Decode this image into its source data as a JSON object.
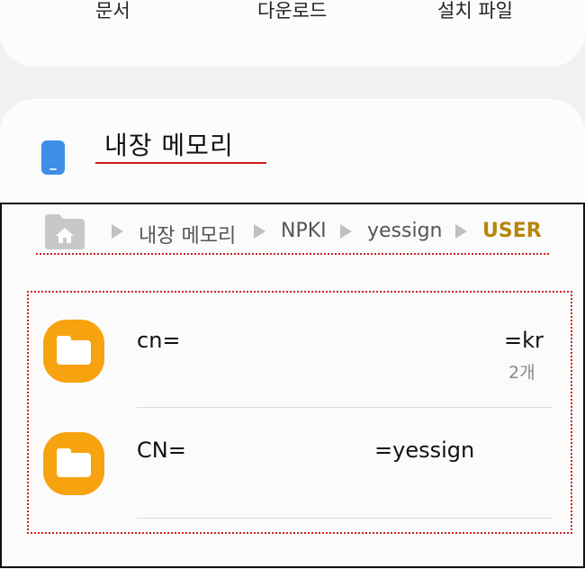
{
  "categories": {
    "documents": "문서",
    "downloads": "다운로드",
    "install_files": "설치 파일"
  },
  "storage": {
    "title": "내장 메모리"
  },
  "breadcrumb": {
    "items": [
      "내장 메모리",
      "NPKI",
      "yessign",
      "USER"
    ]
  },
  "files": [
    {
      "name_start": "cn=",
      "name_end": "=kr",
      "count": "2개"
    },
    {
      "name_start": "CN=",
      "name_end": "=yessign"
    }
  ],
  "colors": {
    "folder": "#f7a20f",
    "phone": "#3d8ee6",
    "active_crumb": "#b7860a",
    "annotation": "#d01818"
  }
}
